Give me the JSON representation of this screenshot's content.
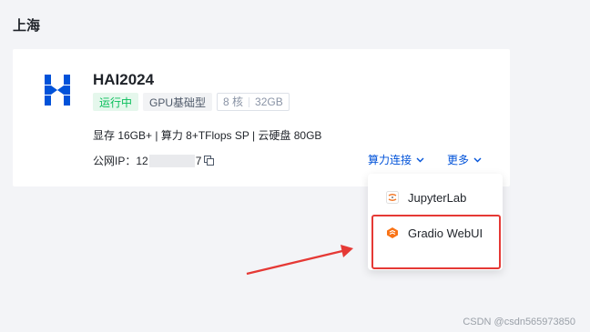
{
  "region": {
    "title": "上海"
  },
  "instance": {
    "name": "HAI2024",
    "status": "运行中",
    "type": "GPU基础型",
    "cores": "8 核",
    "memory": "32GB",
    "specs": "显存 16GB+ | 算力 8+TFlops SP | 云硬盘 80GB",
    "ip_label": "公网IP：",
    "ip_prefix": "12",
    "ip_suffix": "7"
  },
  "actions": {
    "connect_label": "算力连接",
    "more_label": "更多"
  },
  "dropdown": {
    "items": [
      {
        "label": "JupyterLab",
        "icon": "jupyter-icon"
      },
      {
        "label": "Gradio WebUI",
        "icon": "gradio-icon"
      }
    ]
  },
  "watermark": "CSDN @csdn565973850",
  "colors": {
    "accent": "#0052d9",
    "running": "#0abf5b",
    "annotation": "#e53935",
    "gradio": "#f97316",
    "logo": "#0052d9"
  }
}
